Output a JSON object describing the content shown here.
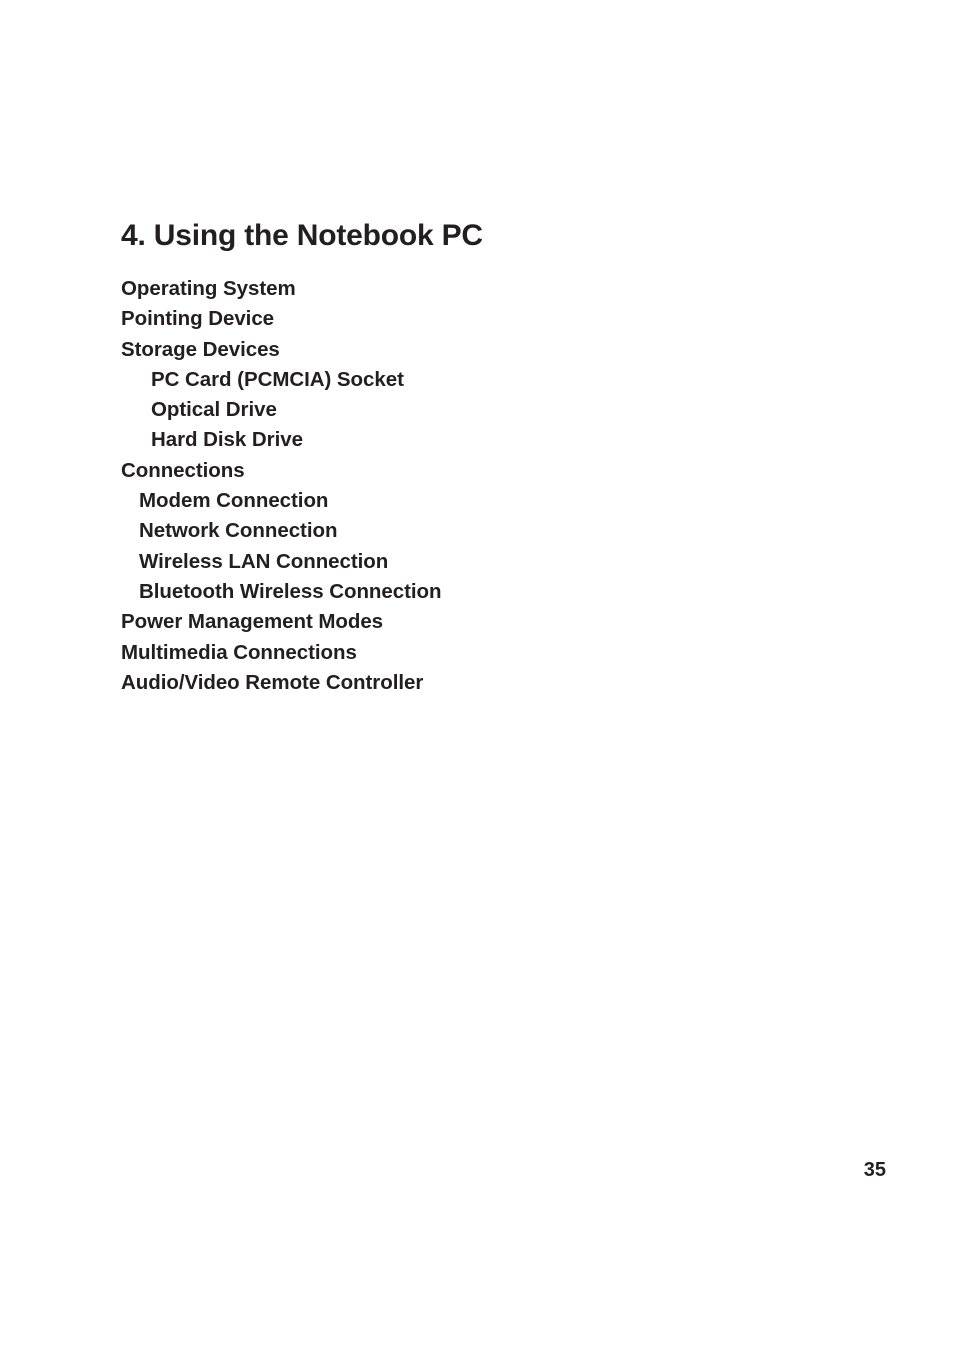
{
  "document": {
    "chapter_title": "4. Using the Notebook PC",
    "page_number": "35",
    "text_color": "#231f20",
    "background_color": "#ffffff",
    "contents": [
      {
        "label": "Operating System",
        "level": 0
      },
      {
        "label": "Pointing Device",
        "level": 0
      },
      {
        "label": "Storage Devices",
        "level": 0
      },
      {
        "label": "PC Card (PCMCIA) Socket",
        "level": 2
      },
      {
        "label": "Optical Drive",
        "level": 2
      },
      {
        "label": "Hard Disk Drive",
        "level": 2
      },
      {
        "label": "Connections",
        "level": 0
      },
      {
        "label": "Modem Connection",
        "level": 1
      },
      {
        "label": "Network Connection",
        "level": 1
      },
      {
        "label": "Wireless LAN Connection",
        "level": 1
      },
      {
        "label": "Bluetooth Wireless Connection",
        "level": 1
      },
      {
        "label": "Power Management Modes",
        "level": 0
      },
      {
        "label": "Multimedia Connections",
        "level": 0
      },
      {
        "label": "Audio/Video Remote Controller",
        "level": 0
      }
    ]
  }
}
